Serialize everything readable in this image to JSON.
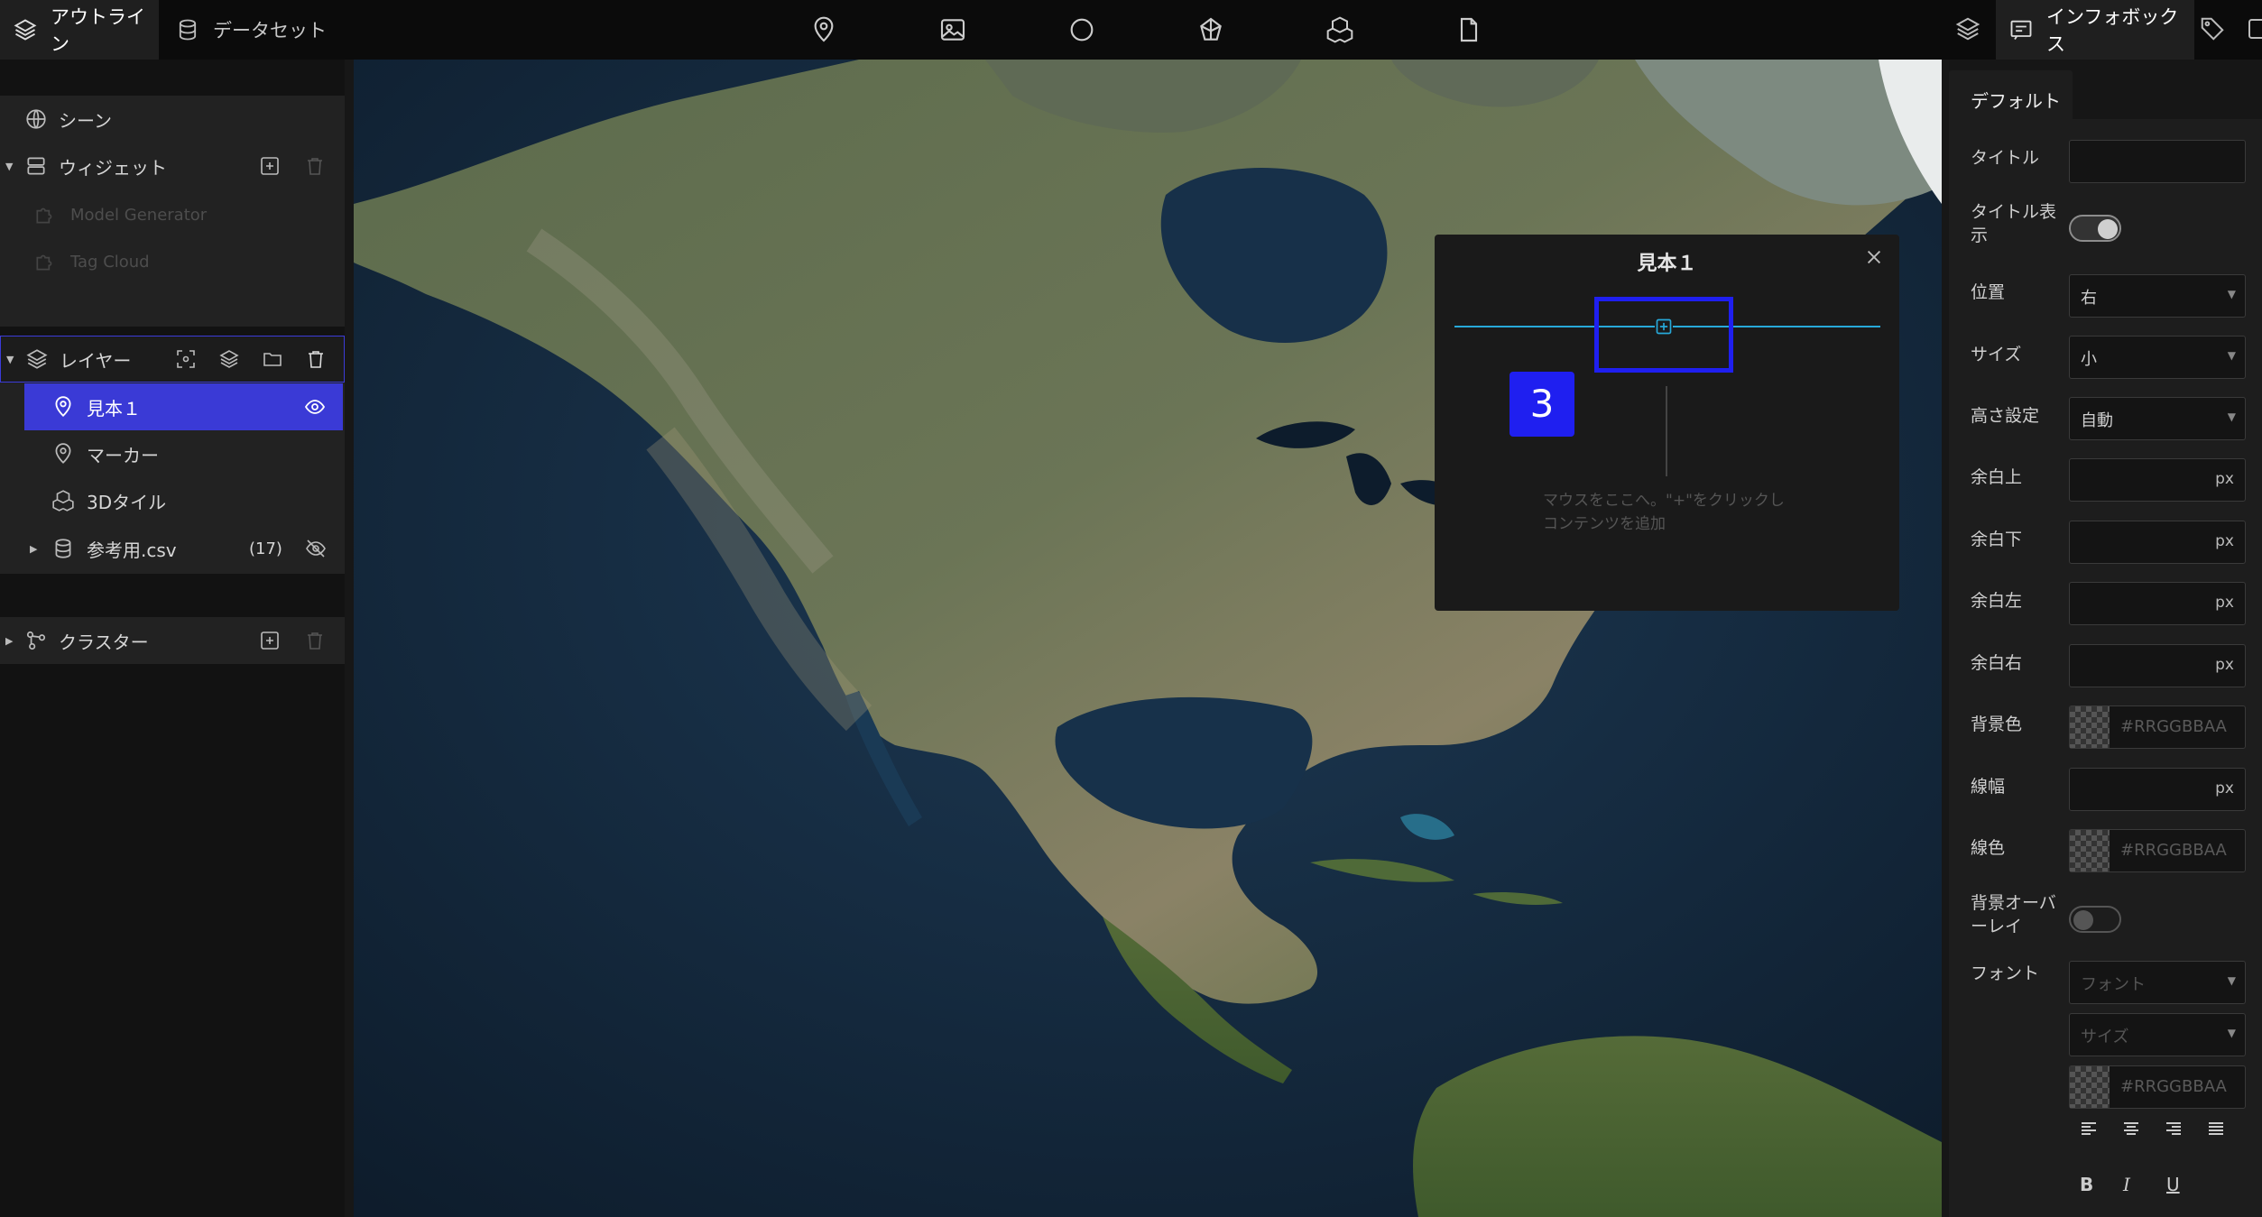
{
  "topbar": {
    "tab_outline": "アウトライン",
    "tab_dataset": "データセット",
    "tab_infobox": "インフォボックス",
    "center_icons": [
      "map-pin-icon",
      "image-icon",
      "circle-icon",
      "polyhedron-icon",
      "3d-tiles-icon",
      "document-icon"
    ]
  },
  "left": {
    "scene": "シーン",
    "widget": "ウィジェット",
    "widget_items": [
      "Model Generator",
      "Tag Cloud"
    ],
    "layer": "レイヤー",
    "layer_items": [
      {
        "label": "見本１",
        "selected": true
      },
      {
        "label": "マーカー"
      },
      {
        "label": "3Dタイル"
      },
      {
        "label": "参考用.csv",
        "count": "(17)"
      }
    ],
    "cluster": "クラスター"
  },
  "infobox": {
    "title": "見本１",
    "step_badge": "3",
    "hint_line1": "マウスをここへ。\"+\"をクリックし",
    "hint_line2": "コンテンツを追加"
  },
  "right": {
    "tab": "デフォルト",
    "labels": {
      "title": "タイトル",
      "title_show_1": "タイトル表",
      "title_show_2": "示",
      "position": "位置",
      "size": "サイズ",
      "height": "高さ設定",
      "margin_top": "余白上",
      "margin_bottom": "余白下",
      "margin_left": "余白左",
      "margin_right": "余白右",
      "bg_color": "背景色",
      "line_width": "線幅",
      "line_color": "線色",
      "bg_overlay_1": "背景オーバ",
      "bg_overlay_2": "ーレイ",
      "font": "フォント"
    },
    "values": {
      "position": "右",
      "size": "小",
      "height": "自動",
      "unit": "px",
      "color_placeholder": "#RRGGBBAA",
      "font_placeholder": "フォント",
      "font_size_placeholder": "サイズ"
    },
    "title_toggle_on": true,
    "overlay_toggle_on": false,
    "text_style": {
      "bold": "B",
      "italic": "I",
      "underline": "U"
    }
  },
  "colors": {
    "accent": "#3a3ad6",
    "highlight_box": "#1f1ff0",
    "line": "#27a9d9"
  }
}
